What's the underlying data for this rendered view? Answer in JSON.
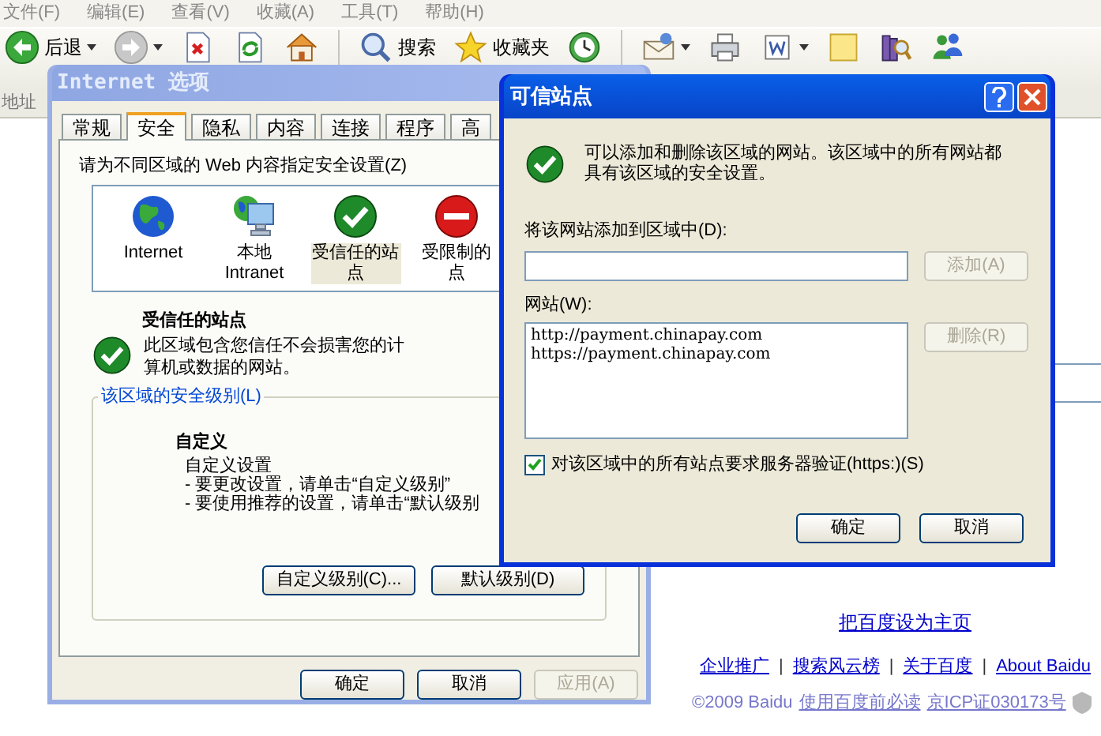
{
  "browser": {
    "menu": [
      "文件(F)",
      "编辑(E)",
      "查看(V)",
      "收藏(A)",
      "工具(T)",
      "帮助(H)"
    ],
    "toolbar": [
      {
        "kind": "back",
        "label": "后退",
        "dropdown": true
      },
      {
        "kind": "forward",
        "dropdown": true
      },
      {
        "kind": "stop",
        "dropdown": false
      },
      {
        "kind": "refresh",
        "dropdown": false
      },
      {
        "kind": "home",
        "dropdown": false
      },
      {
        "kind": "search",
        "label": "搜索",
        "dropdown": false
      },
      {
        "kind": "favorites",
        "label": "收藏夹",
        "dropdown": false
      },
      {
        "kind": "history",
        "dropdown": false
      },
      {
        "kind": "mail",
        "dropdown": true
      },
      {
        "kind": "print",
        "dropdown": false
      },
      {
        "kind": "word",
        "dropdown": true
      },
      {
        "kind": "note",
        "dropdown": false
      },
      {
        "kind": "research",
        "dropdown": false
      },
      {
        "kind": "messenger",
        "dropdown": false
      }
    ],
    "address_label": "地址"
  },
  "internet_options": {
    "title": "Internet 选项",
    "tabs": [
      {
        "label": "常规",
        "selected": false
      },
      {
        "label": "安全",
        "selected": true
      },
      {
        "label": "隐私",
        "selected": false
      },
      {
        "label": "内容",
        "selected": false
      },
      {
        "label": "连接",
        "selected": false
      },
      {
        "label": "程序",
        "selected": false
      },
      {
        "label": "高",
        "selected": false
      }
    ],
    "zones_prompt": "请为不同区域的 Web 内容指定安全设置(Z)",
    "zones": [
      {
        "kind": "internet",
        "lines": [
          "Internet"
        ],
        "selected": false
      },
      {
        "kind": "intranet",
        "lines": [
          "本地",
          "Intranet"
        ],
        "selected": false
      },
      {
        "kind": "trusted",
        "lines": [
          "受信任的站",
          "点"
        ],
        "selected": true
      },
      {
        "kind": "restricted",
        "lines": [
          "受限制的",
          "点"
        ],
        "selected": false
      }
    ],
    "zone_title": "受信任的站点",
    "zone_description": [
      "此区域包含您信任不会损害您的计",
      "算机或数据的网站。"
    ],
    "security_level": {
      "legend": "该区域的安全级别(L)",
      "name": "自定义",
      "lines": [
        "自定义设置",
        "- 要更改设置，请单击“自定义级别”",
        "- 要使用推荐的设置，请单击“默认级别"
      ],
      "buttons": [
        {
          "label": "自定义级别(C)...",
          "disabled": false
        },
        {
          "label": "默认级别(D)",
          "disabled": false
        }
      ]
    },
    "buttons": [
      {
        "label": "确定",
        "disabled": false
      },
      {
        "label": "取消",
        "disabled": false
      },
      {
        "label": "应用(A)",
        "disabled": true
      }
    ]
  },
  "trusted_sites": {
    "title": "可信站点",
    "message": "可以添加和删除该区域的网站。该区域中的所有网站都具有该区域的安全设置。",
    "add_label": "将该网站添加到区域中(D):",
    "add_button": {
      "label": "添加(A)",
      "disabled": true
    },
    "sites_label": "网站(W):",
    "sites": [
      "http://payment.chinapay.com",
      "https://payment.chinapay.com"
    ],
    "remove_button": {
      "label": "删除(R)",
      "disabled": true
    },
    "require_https": {
      "label": "对该区域中的所有站点要求服务器验证(https:)(S)",
      "checked": true
    },
    "buttons": [
      {
        "label": "确定",
        "disabled": false
      },
      {
        "label": "取消",
        "disabled": false
      }
    ]
  },
  "baidu": {
    "set_home": "把百度设为主页",
    "links": [
      {
        "kind": "link",
        "text": "企业推广"
      },
      {
        "kind": "separator",
        "text": "|"
      },
      {
        "kind": "link",
        "text": "搜索风云榜"
      },
      {
        "kind": "separator",
        "text": "|"
      },
      {
        "kind": "link",
        "text": "关于百度"
      },
      {
        "kind": "separator",
        "text": "|"
      },
      {
        "kind": "link",
        "text": "About Baidu"
      }
    ],
    "copyright": "©2009 Baidu",
    "footer_links": [
      "使用百度前必读",
      "京ICP证030173号"
    ]
  }
}
